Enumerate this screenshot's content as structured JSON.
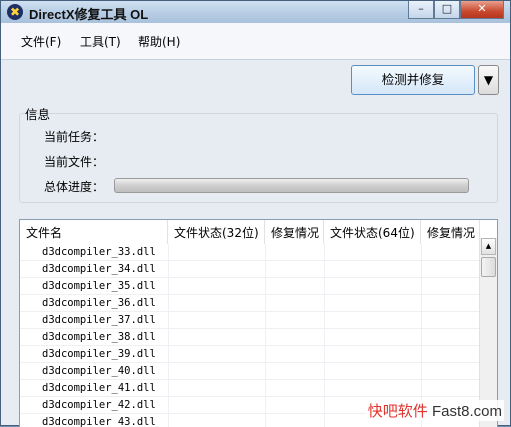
{
  "window": {
    "title": "DirectX修复工具 OL",
    "controls": {
      "minimize": "–",
      "maximize": "□",
      "close": "✕"
    }
  },
  "menu": [
    "文件(F)",
    "工具(T)",
    "帮助(H)"
  ],
  "actions": {
    "main_button": "检测并修复",
    "dropdown_glyph": "▼"
  },
  "info": {
    "group_title": "信息",
    "task_label": "当前任务：",
    "file_label": "当前文件：",
    "progress_label": "总体进度：",
    "progress_value": 0
  },
  "list": {
    "columns": [
      "文件名",
      "文件状态(32位)",
      "修复情况",
      "文件状态(64位)",
      "修复情况"
    ],
    "rows": [
      "d3dcompiler_33.dll",
      "d3dcompiler_34.dll",
      "d3dcompiler_35.dll",
      "d3dcompiler_36.dll",
      "d3dcompiler_37.dll",
      "d3dcompiler_38.dll",
      "d3dcompiler_39.dll",
      "d3dcompiler_40.dll",
      "d3dcompiler_41.dll",
      "d3dcompiler_42.dll",
      "d3dcompiler_43.dll"
    ]
  },
  "watermark": {
    "part1": "快吧软件",
    "part2": " Fast8.com"
  }
}
